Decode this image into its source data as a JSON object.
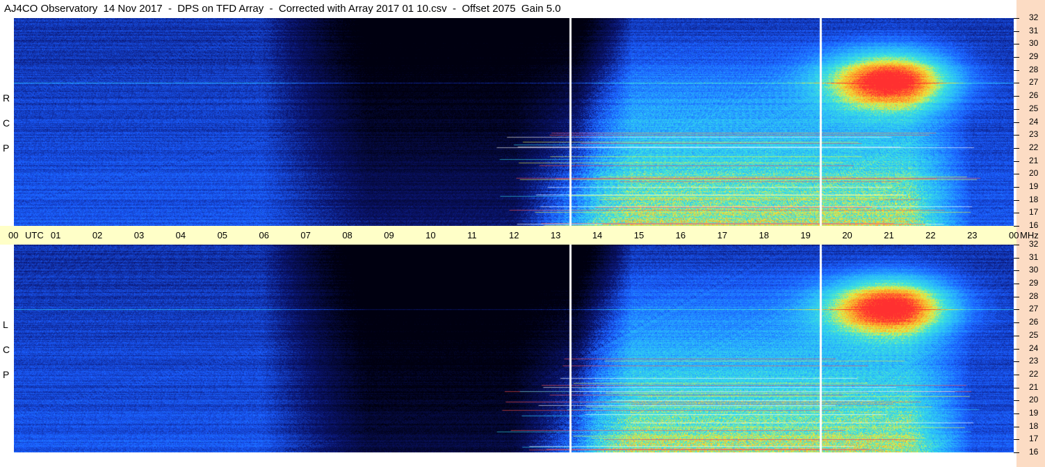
{
  "title": "AJ4CO Observatory  14 Nov 2017  -  DPS on TFD Array  -  Corrected with Array 2017 01 10.csv  -  Offset 2075  Gain 5.0",
  "colors": {
    "background_deep": "#000010",
    "background_blue": "#1a5cff",
    "axis_bar": "#ffffc8",
    "right_strip": "#fcdcc4",
    "burst_cyan": "#30e0ff",
    "burst_yellow": "#e8f040",
    "burst_red": "#ff3030"
  },
  "chart_data": {
    "type": "heatmap",
    "title": "AJ4CO Observatory  14 Nov 2017  -  DPS on TFD Array  -  Corrected with Array 2017 01 10.csv  -  Offset 2075  Gain 5.0",
    "x_unit": "UTC",
    "x_ticks": [
      "00",
      "01",
      "02",
      "03",
      "04",
      "05",
      "06",
      "07",
      "08",
      "09",
      "10",
      "11",
      "12",
      "13",
      "14",
      "15",
      "16",
      "17",
      "18",
      "19",
      "20",
      "21",
      "22",
      "23",
      "00"
    ],
    "x_range_hours": [
      0,
      24
    ],
    "y_unit": "MHz",
    "y_ticks": [
      "16",
      "17",
      "18",
      "19",
      "20",
      "21",
      "22",
      "23",
      "24",
      "25",
      "26",
      "27",
      "28",
      "29",
      "30",
      "31",
      "32"
    ],
    "y_range_mhz": [
      16,
      32
    ],
    "panels": [
      {
        "name": "RCP",
        "label_letters": [
          "R",
          "C",
          "P"
        ]
      },
      {
        "name": "LCP",
        "label_letters": [
          "L",
          "C",
          "P"
        ]
      }
    ],
    "dividers_utc_hours": [
      13.33,
      19.35
    ],
    "features": {
      "night_darkening_utc": [
        8.5,
        13.5
      ],
      "interference_band_mhz": 27.0,
      "daytime_activity_utc": [
        12.0,
        23.0
      ],
      "bright_burst_center_utc": 21.0,
      "bright_burst_center_mhz": 27.2
    }
  }
}
